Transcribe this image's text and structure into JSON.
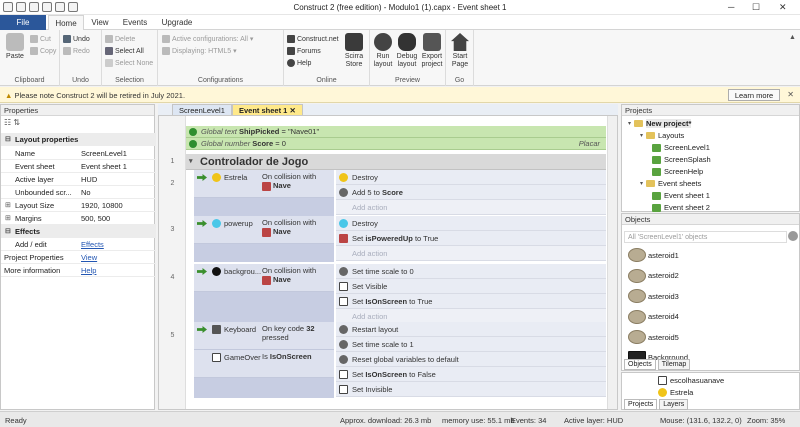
{
  "window": {
    "title": "Construct 2  (free edition) - Modulo1 (1).capx - Event sheet 1"
  },
  "tabs": [
    "File",
    "Home",
    "View",
    "Events",
    "Upgrade"
  ],
  "ribbon": {
    "clipboard": {
      "paste": "Paste",
      "cut": "Cut",
      "copy": "Copy",
      "label": "Clipboard"
    },
    "undo": {
      "undo": "Undo",
      "redo": "Redo",
      "label": "Undo"
    },
    "selection": {
      "delete": "Delete",
      "select_all": "Select All",
      "select_none": "Select None",
      "label": "Selection"
    },
    "configurations": {
      "active": "Active configurations: All",
      "displaying": "Displaying:  HTML5",
      "label": "Configurations"
    },
    "online": {
      "construct": "Construct.net",
      "forums": "Forums",
      "help": "Help",
      "scirra": "Scirra Store",
      "label": "Online"
    },
    "preview": {
      "run": "Run layout",
      "debug": "Debug layout",
      "export": "Export project",
      "label": "Preview"
    },
    "go": {
      "start": "Start Page",
      "label": "Go"
    }
  },
  "notice": {
    "text": "Please note Construct 2 will be retired in July 2021.",
    "button": "Learn more"
  },
  "properties": {
    "title": "Properties",
    "rows": [
      {
        "type": "cat",
        "key": "Layout properties"
      },
      {
        "key": "Name",
        "value": "ScreenLevel1"
      },
      {
        "key": "Event sheet",
        "value": "Event sheet 1"
      },
      {
        "key": "Active layer",
        "value": "HUD"
      },
      {
        "key": "Unbounded scr...",
        "value": "No"
      },
      {
        "key": "Layout Size",
        "value": "1920, 10800",
        "toggle": true
      },
      {
        "key": "Margins",
        "value": "500, 500",
        "toggle": true
      },
      {
        "type": "cat",
        "key": "Effects"
      },
      {
        "key": "Add / edit",
        "value": "Effects",
        "link": true
      },
      {
        "key": "Project Properties",
        "value": "View",
        "link": true,
        "top": true
      },
      {
        "key": "More information",
        "value": "Help",
        "link": true,
        "top": true
      }
    ]
  },
  "doc_tabs": [
    "ScreenLevel1",
    "Event sheet 1"
  ],
  "events": {
    "globals": [
      {
        "kind": "Global text",
        "name": "ShipPicked",
        "value": "= \"Nave01\""
      },
      {
        "kind": "Global number",
        "name": "Score",
        "value": "= 0",
        "comment": "Placar"
      }
    ],
    "group": {
      "num": "1",
      "title": "Controlador de Jogo"
    },
    "list": [
      {
        "num": "2",
        "conds": [
          {
            "obj": "Estrela",
            "text": "On collision with",
            "bold": "Nave"
          }
        ],
        "acts": [
          {
            "t": "Destroy"
          },
          {
            "t": "Add 5 to ",
            "b": "Score"
          }
        ],
        "add": "Add action"
      },
      {
        "num": "3",
        "conds": [
          {
            "obj": "powerup",
            "text": "On collision with",
            "bold": "Nave"
          }
        ],
        "acts": [
          {
            "t": "Destroy"
          },
          {
            "t": "Set ",
            "b": "isPoweredUp",
            "r": " to True"
          }
        ],
        "add": "Add action"
      },
      {
        "num": "4",
        "conds": [
          {
            "obj": "backgrou...",
            "text": "On collision with",
            "bold": "Nave"
          }
        ],
        "acts": [
          {
            "t": "Set time scale to 0"
          },
          {
            "t": "Set Visible"
          },
          {
            "t": "Set ",
            "b": "IsOnScreen",
            "r": " to True"
          }
        ],
        "add": "Add action"
      },
      {
        "num": "5",
        "conds": [
          {
            "obj": "Keyboard",
            "text": "On key code ",
            "bold": "32",
            "text2": "pressed"
          },
          {
            "obj": "GameOver",
            "text": "Is ",
            "bold": "IsOnScreen"
          }
        ],
        "acts": [
          {
            "t": "Restart layout"
          },
          {
            "t": "Set time scale to 1"
          },
          {
            "t": "Reset global variables to default"
          },
          {
            "t": "Set ",
            "b": "IsOnScreen",
            "r": " to False"
          },
          {
            "t": "Set Invisible"
          }
        ],
        "add": ""
      }
    ]
  },
  "projects": {
    "title": "Projects",
    "items": [
      {
        "label": "New project*",
        "level": 0,
        "bold": true
      },
      {
        "label": "Layouts",
        "level": 1
      },
      {
        "label": "ScreenLevel1",
        "level": 2
      },
      {
        "label": "ScreenSplash",
        "level": 2
      },
      {
        "label": "ScreenHelp",
        "level": 2
      },
      {
        "label": "Event sheets",
        "level": 1
      },
      {
        "label": "Event sheet 1",
        "level": 2
      },
      {
        "label": "Event sheet 2",
        "level": 2
      }
    ]
  },
  "objects": {
    "title": "Objects",
    "filter": "All 'ScreenLevel1' objects",
    "items": [
      "asteroid1",
      "asteroid2",
      "asteroid3",
      "asteroid4",
      "asteroid5",
      "Background"
    ],
    "tabs": [
      "Objects",
      "Tilemap"
    ],
    "extra": [
      "escolhasuanave",
      "Estrela"
    ],
    "bottom_tabs": [
      "Projects",
      "Layers"
    ]
  },
  "status": {
    "ready": "Ready",
    "download": "Approx. download: 26.3 mb",
    "memory": "memory use: 55.1 mb",
    "events": "Events: 34",
    "layer": "Active layer: HUD",
    "mouse": "Mouse: (131.6, 132.2, 0)",
    "zoom": "Zoom: 35%"
  }
}
